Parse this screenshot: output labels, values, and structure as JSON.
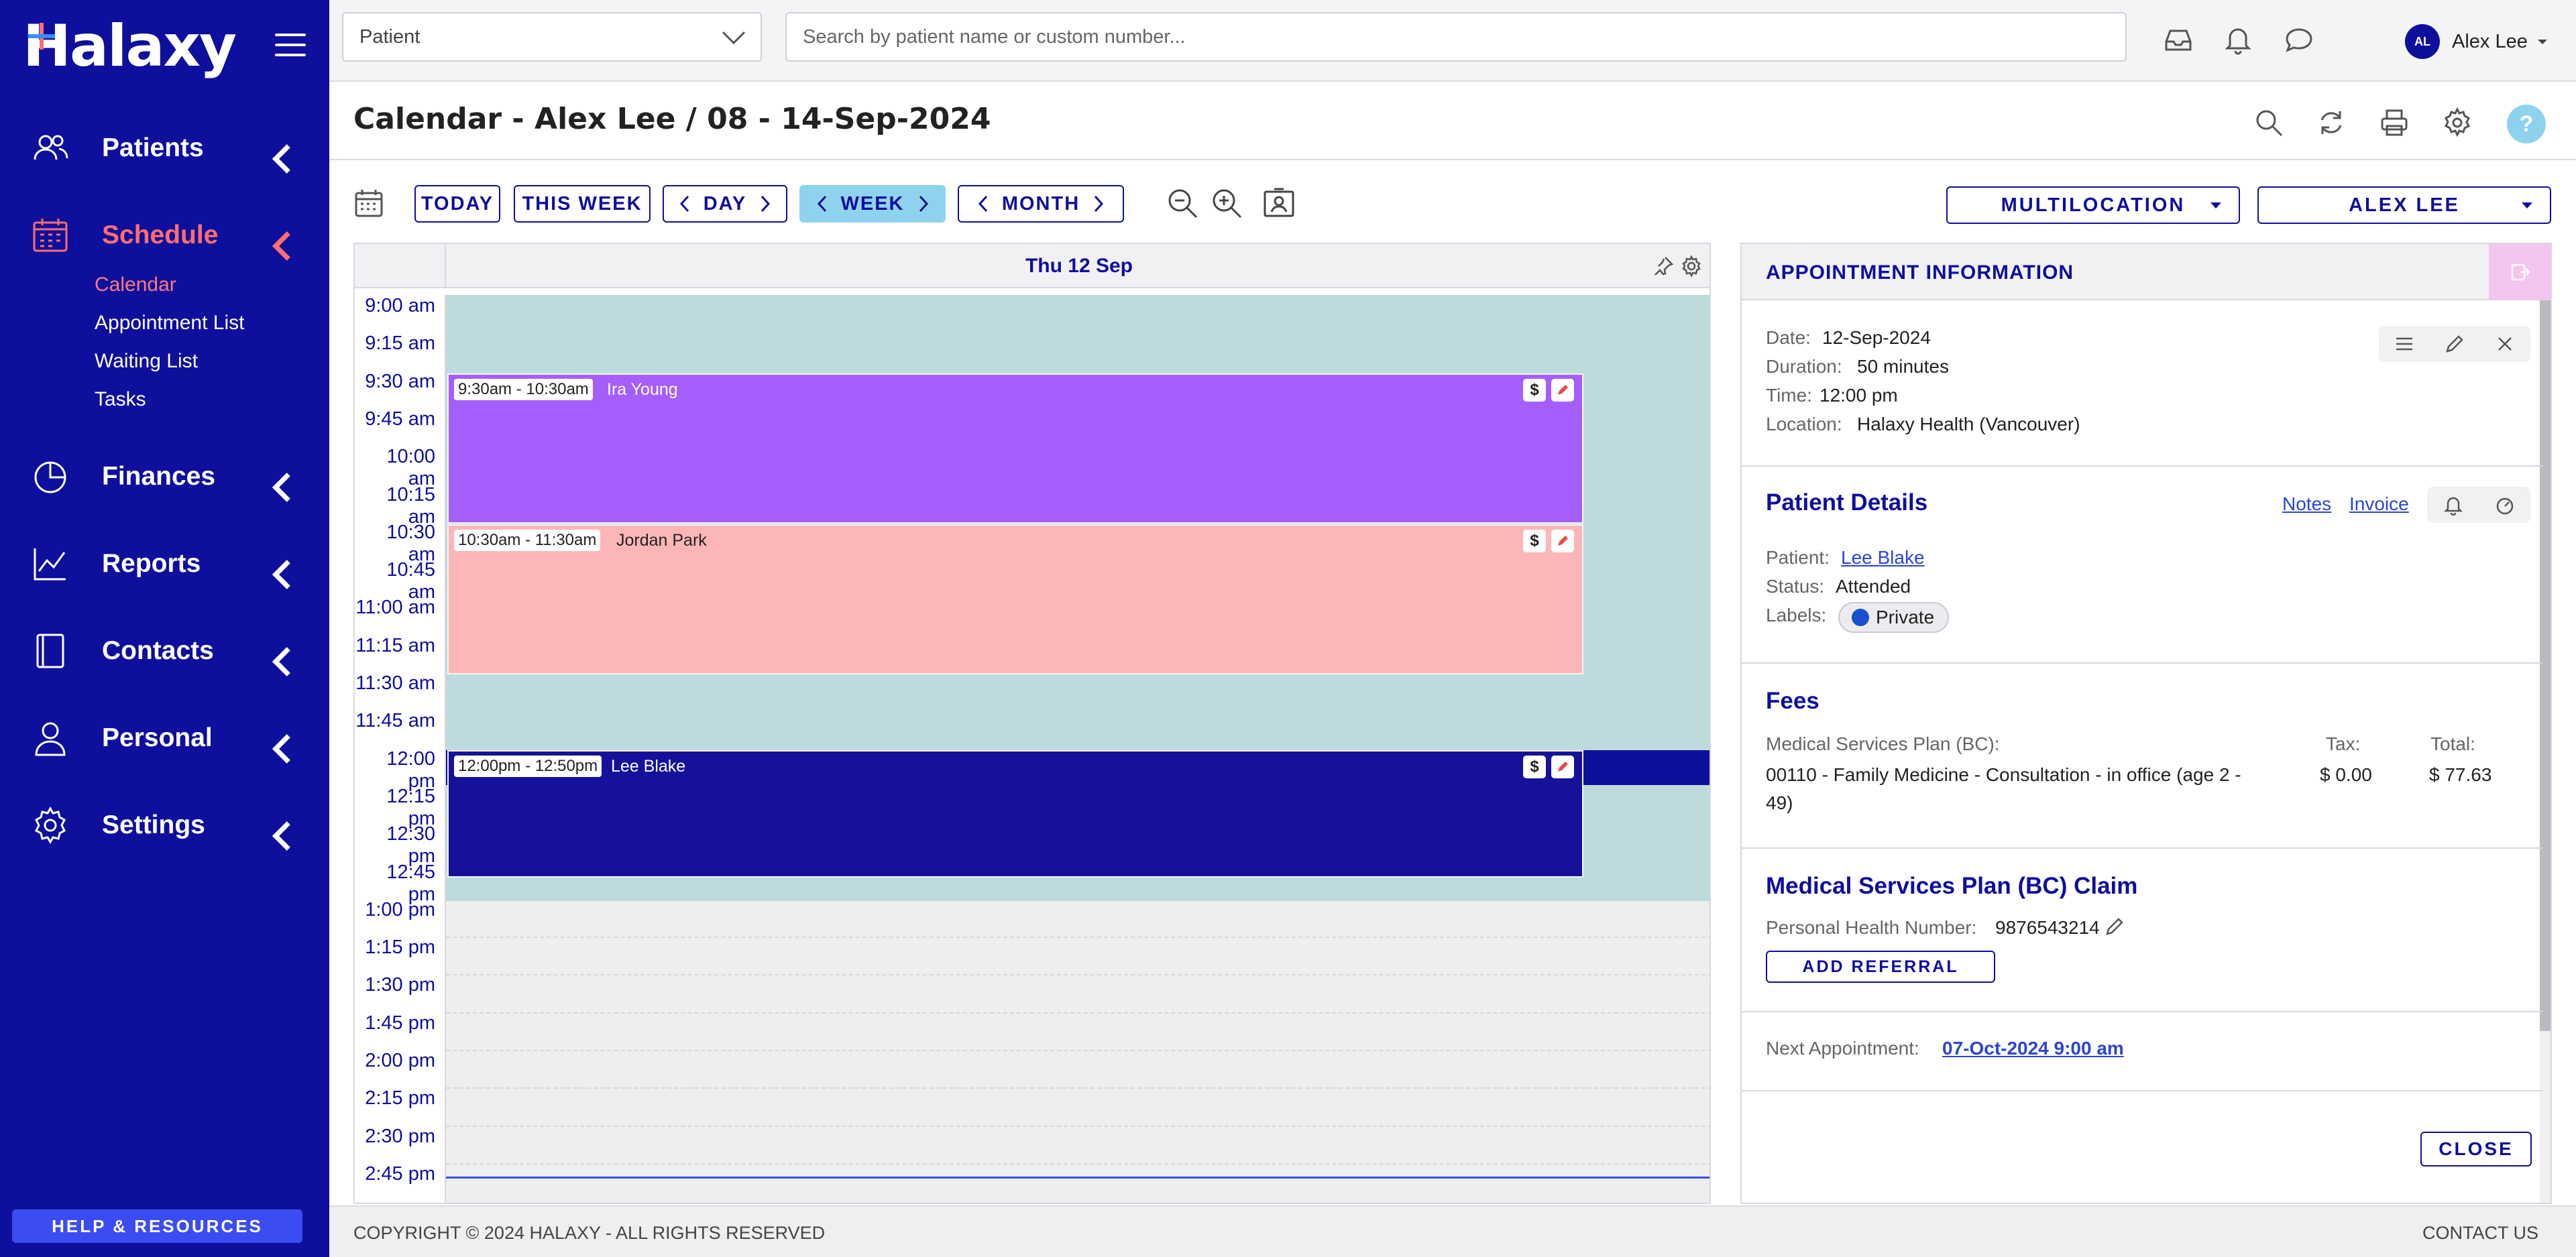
{
  "brand": {
    "logo_text": "Halaxy",
    "accent": "#ff6e6e",
    "sidebar_bg": "#0e0f9c"
  },
  "sidebar": {
    "items": [
      {
        "label": "Patients",
        "icon": "users-icon"
      },
      {
        "label": "Schedule",
        "icon": "calendar-icon",
        "active": true
      },
      {
        "label": "Finances",
        "icon": "pie-chart-icon"
      },
      {
        "label": "Reports",
        "icon": "line-chart-icon"
      },
      {
        "label": "Contacts",
        "icon": "book-icon"
      },
      {
        "label": "Personal",
        "icon": "person-icon"
      },
      {
        "label": "Settings",
        "icon": "gear-icon"
      }
    ],
    "sub_items": [
      "Calendar",
      "Appointment List",
      "Waiting List",
      "Tasks"
    ],
    "help": "HELP & RESOURCES"
  },
  "topbar": {
    "patient_select": "Patient",
    "search_placeholder": "Search by patient name or custom number...",
    "user_initials": "AL",
    "user_name": "Alex Lee"
  },
  "page": {
    "title": "Calendar - Alex Lee / 08 - 14-Sep-2024",
    "help_glyph": "?"
  },
  "toolbar": {
    "today": "TODAY",
    "this_week": "THIS WEEK",
    "day": "DAY",
    "week": "WEEK",
    "month": "MONTH",
    "multilocation": "MULTILOCATION",
    "practitioner": "ALEX LEE"
  },
  "calendar": {
    "day_label": "Thu 12 Sep",
    "times": [
      "9:00 am",
      "9:15 am",
      "9:30 am",
      "9:45 am",
      "10:00 am",
      "10:15 am",
      "10:30 am",
      "10:45 am",
      "11:00 am",
      "11:15 am",
      "11:30 am",
      "11:45 am",
      "12:00 pm",
      "12:15 pm",
      "12:30 pm",
      "12:45 pm",
      "1:00 pm",
      "1:15 pm",
      "1:30 pm",
      "1:45 pm",
      "2:00 pm",
      "2:15 pm",
      "2:30 pm",
      "2:45 pm"
    ],
    "appointments": [
      {
        "time": "9:30am - 10:30am",
        "name": "Ira Young",
        "color": "#a55efc",
        "badge": "$"
      },
      {
        "time": "10:30am - 11:30am",
        "name": "Jordan Park",
        "color": "#fdb6b8",
        "badge": "$"
      },
      {
        "time": "12:00pm - 12:50pm",
        "name": "Lee Blake",
        "color": "#16119a",
        "badge": "$"
      }
    ]
  },
  "panel": {
    "title": "APPOINTMENT INFORMATION",
    "date_label": "Date:",
    "date": "12-Sep-2024",
    "duration_label": "Duration:",
    "duration": "50 minutes",
    "time_label": "Time:",
    "time": "12:00 pm",
    "location_label": "Location:",
    "location": "Halaxy Health (Vancouver)",
    "patient_details": "Patient Details",
    "notes": "Notes",
    "invoice": "Invoice",
    "patient_label": "Patient:",
    "patient": "Lee Blake",
    "status_label": "Status:",
    "status": "Attended",
    "labels_label": "Labels:",
    "label_chip": "Private",
    "fees_title": "Fees",
    "fee_plan": "Medical Services Plan (BC):",
    "tax_label": "Tax:",
    "total_label": "Total:",
    "fee_item_1": "00110 - Family Medicine - Consultation - in office (age 2 -",
    "fee_item_2": "49)",
    "tax": "$ 0.00",
    "total": "$ 77.63",
    "claim_title": "Medical Services Plan (BC) Claim",
    "phn_label": "Personal Health Number:",
    "phn": "9876543214",
    "add_referral": "ADD REFERRAL",
    "next_label": "Next Appointment:",
    "next": "07-Oct-2024 9:00 am",
    "close": "CLOSE"
  },
  "footer": {
    "copyright": "COPYRIGHT © 2024 HALAXY - ALL RIGHTS RESERVED",
    "contact": "CONTACT US"
  }
}
